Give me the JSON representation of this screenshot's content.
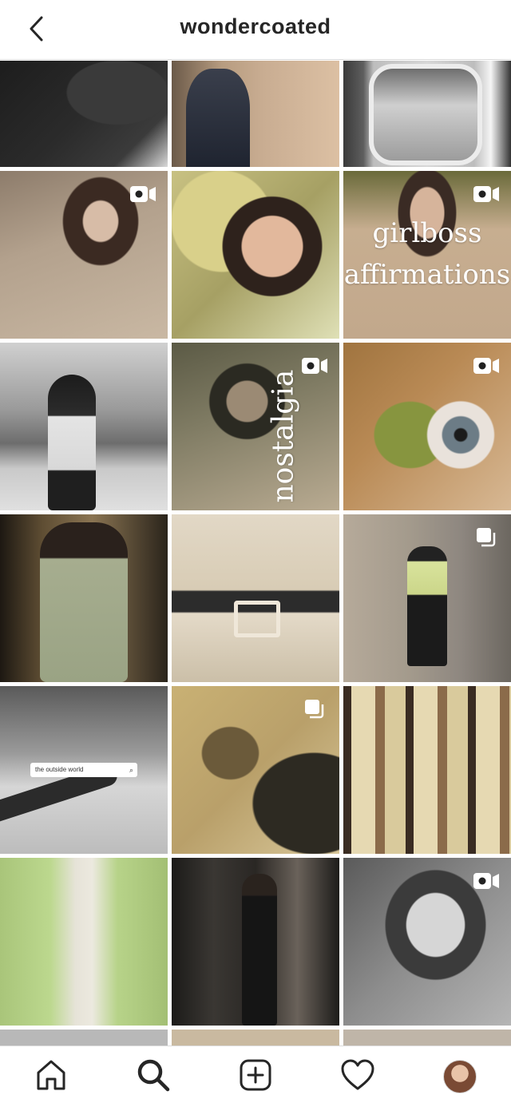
{
  "header": {
    "title": "wondercoated",
    "back_icon": "chevron-left-icon"
  },
  "posts": [
    {
      "type": "image",
      "description": "coat detail",
      "tone": "#2a2a2a"
    },
    {
      "type": "image",
      "description": "denim jacket",
      "tone": "#b89a82"
    },
    {
      "type": "image",
      "description": "airplane window",
      "tone": "#8a8a8a"
    },
    {
      "type": "video",
      "description": "beige hoodie",
      "tone": "#a08e7c"
    },
    {
      "type": "image",
      "description": "ruffle sweater portrait",
      "tone": "#b9b07a"
    },
    {
      "type": "video",
      "description": "girlboss affirmations",
      "tone": "#c1a98d",
      "overlay_text": [
        "girlboss",
        "affirmations"
      ]
    },
    {
      "type": "image",
      "description": "winter street",
      "tone": "#7d7d7d"
    },
    {
      "type": "video",
      "description": "nostalgia",
      "tone": "#7f7a63",
      "overlay_text": [
        "nostalgia"
      ]
    },
    {
      "type": "video",
      "description": "green eyeshadow",
      "tone": "#9b7a5a"
    },
    {
      "type": "image",
      "description": "sunglasses blazer",
      "tone": "#6f5c3e"
    },
    {
      "type": "image",
      "description": "trench belt",
      "tone": "#d8cdb8"
    },
    {
      "type": "carousel",
      "description": "street outfit",
      "tone": "#8b8680"
    },
    {
      "type": "image",
      "description": "plane wing search",
      "tone": "#9a9a9a",
      "search_text": "the outside world"
    },
    {
      "type": "carousel",
      "description": "hand shadow earring",
      "tone": "#b5a070"
    },
    {
      "type": "image",
      "description": "curtain photos",
      "tone": "#cdbf94"
    },
    {
      "type": "image",
      "description": "green blazer",
      "tone": "#b7d48c"
    },
    {
      "type": "image",
      "description": "elevator outfit",
      "tone": "#2c2a28"
    },
    {
      "type": "video",
      "description": "bw portrait",
      "tone": "#8c8c8c"
    }
  ],
  "bottom_nav": {
    "items": [
      {
        "name": "home-icon"
      },
      {
        "name": "search-icon"
      },
      {
        "name": "new-post-icon"
      },
      {
        "name": "heart-icon"
      },
      {
        "name": "profile-avatar"
      }
    ]
  }
}
